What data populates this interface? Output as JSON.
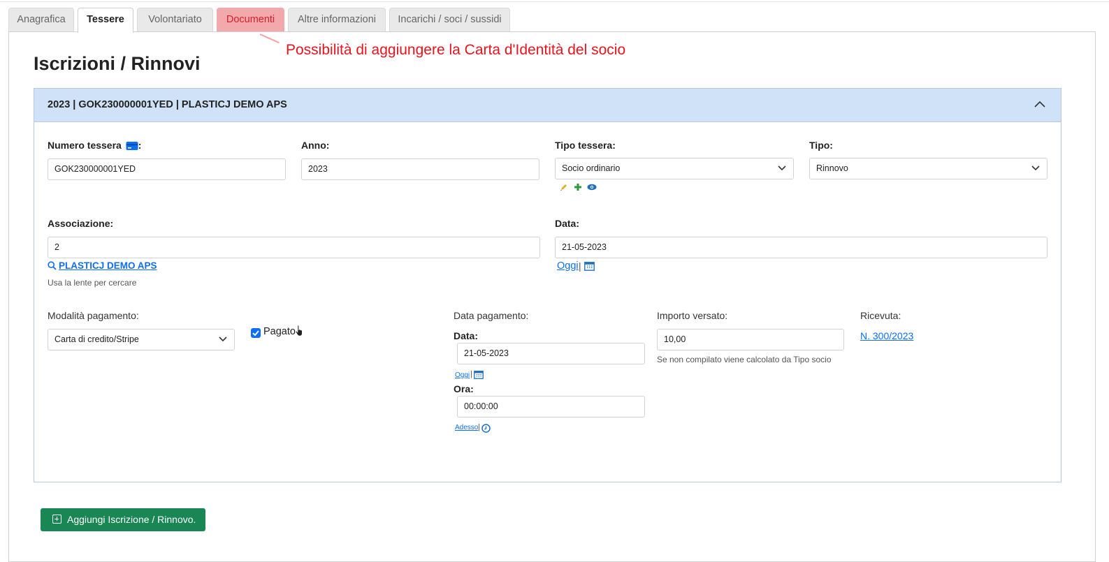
{
  "tabs": [
    "Anagrafica",
    "Tessere",
    "Volontariato",
    "Documenti",
    "Altre informazioni",
    "Incarichi / soci / sussidi"
  ],
  "annotation": "Possibilità di aggiungere la Carta d'Identità del socio",
  "page_title": "Iscrizioni / Rinnovi",
  "card": {
    "header": "2023 | GOK230000001YED | PLASTICJ DEMO APS",
    "numero_tessera_label": "Numero tessera",
    "numero_tessera_colon": ":",
    "numero_tessera_value": "GOK230000001YED",
    "anno_label": "Anno:",
    "anno_value": "2023",
    "tipo_tessera_label": "Tipo tessera:",
    "tipo_tessera_value": "Socio ordinario",
    "tipo_label": "Tipo:",
    "tipo_value": "Rinnovo",
    "associazione_label": "Associazione:",
    "associazione_value": "2",
    "associazione_link": "PLASTICJ DEMO APS",
    "associazione_hint": "Usa la lente per cercare",
    "data_label": "Data:",
    "data_value": "21-05-2023",
    "oggi": "Oggi",
    "sep": "|",
    "modalita_label": "Modalità pagamento:",
    "modalita_value": "Carta di credito/Stripe",
    "pagato_label": "Pagato",
    "pagato_checked": true,
    "data_pagamento_label": "Data pagamento:",
    "dp_data_label": "Data:",
    "dp_data_value": "21-05-2023",
    "dp_oggi": "Oggi",
    "ora_label": "Ora:",
    "ora_value": "00:00:00",
    "adesso": "Adesso",
    "importo_label": "Importo versato:",
    "importo_value": "10,00",
    "importo_hint": "Se non compilato viene calcolato da Tipo socio",
    "ricevuta_label": "Ricevuta:",
    "ricevuta_link": "N. 300/2023"
  },
  "add_button": "Aggiungi Iscrizione / Rinnovo.",
  "colors": {
    "accent": "#0d6efd",
    "success": "#198754",
    "header_bg": "#d0e2f7",
    "annotation": "#e8141d"
  }
}
